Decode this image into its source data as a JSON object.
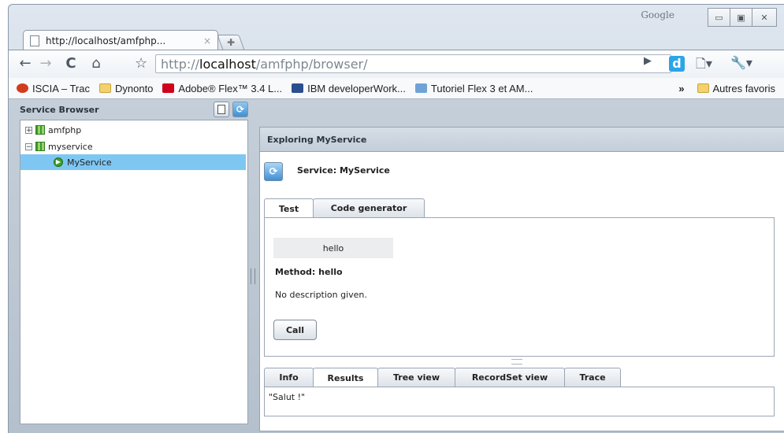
{
  "browser": {
    "search_brand": "Google",
    "tab_title": "http://localhost/amfphp...",
    "tab_close": "×",
    "url_prefix": "http://",
    "url_host": "localhost",
    "url_path": "/amfphp/browser/",
    "window_controls": {
      "minimize": "▭",
      "maximize": "▣",
      "close": "ꕤ"
    }
  },
  "bookmarks": [
    {
      "label": "ISCIA – Trac",
      "icon": "trac-icon",
      "color": "#d23b1c"
    },
    {
      "label": "Dynonto",
      "icon": "folder-icon",
      "color": "#f3d16c"
    },
    {
      "label": "Adobe® Flex™ 3.4 L...",
      "icon": "adobe-icon",
      "color": "#d0021b"
    },
    {
      "label": "IBM developerWork...",
      "icon": "ibm-icon",
      "color": "#2a4f8f"
    },
    {
      "label": "Tutoriel Flex 3 et AM...",
      "icon": "flex-icon",
      "color": "#6fa3d8"
    }
  ],
  "bookmarks_more": "»",
  "other_bookmarks": "Autres favoris",
  "service_browser": {
    "title": "Service Browser",
    "tree": [
      {
        "label": "amfphp",
        "expander": "+"
      },
      {
        "label": "myservice",
        "expander": "−"
      },
      {
        "label": "MyService"
      }
    ]
  },
  "explorer": {
    "title": "Exploring MyService",
    "service_label": "Service: MyService",
    "tabs": [
      "Test",
      "Code generator"
    ],
    "method_button": "hello",
    "method_label": "Method: hello",
    "description": "No description given.",
    "call_label": "Call",
    "result_tabs": [
      "Info",
      "Results",
      "Tree view",
      "RecordSet view",
      "Trace"
    ],
    "result_text": "\"Salut !\""
  }
}
